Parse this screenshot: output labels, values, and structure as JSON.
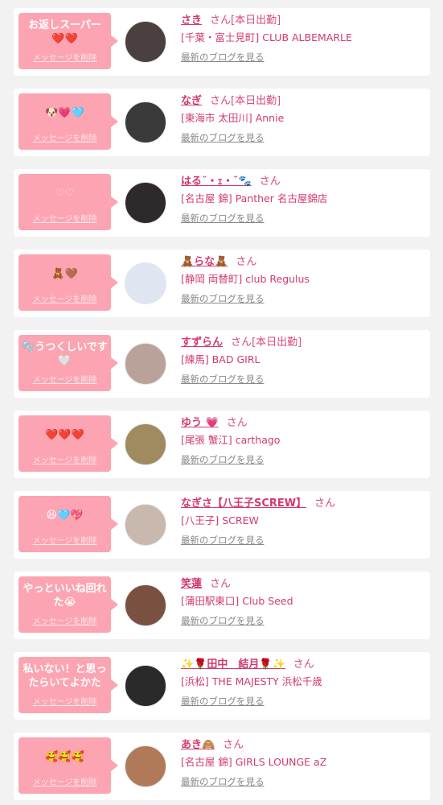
{
  "ui": {
    "delete_label": "メッセージを削除",
    "blog_label": "最新のブログを見る",
    "honorific": "さん"
  },
  "colors": {
    "bubble_pink": "#fca4b2",
    "name_pink": "#d23a6b",
    "link_gray": "#888888",
    "card_bg": "#ffffff",
    "page_bg": "#f2f2f2"
  },
  "entries": [
    {
      "message": "お返しスーパー❤️❤️",
      "faint": false,
      "name": "さき",
      "tag": "[本日出勤]",
      "shop": "[千葉・富士見町] CLUB ALBEMARLE",
      "avatar_bg": "#4a4040"
    },
    {
      "message": "🐶💗🩵",
      "faint": false,
      "name": "なぎ",
      "tag": "[本日出勤]",
      "shop": "[東海市 太田川] Annie",
      "avatar_bg": "#3a3a3a"
    },
    {
      "message": "♡♡",
      "faint": true,
      "name": "はる˘・ｪ・˘🐾",
      "tag": "",
      "shop": "[名古屋 錦] Panther 名古屋錦店",
      "avatar_bg": "#2e2a2c"
    },
    {
      "message": "🧸🤎",
      "faint": false,
      "name": "🧸らな🧸",
      "tag": "",
      "shop": "[静岡 両替町] club Regulus",
      "avatar_bg": "#dfe6f1"
    },
    {
      "message": "🫧うつくしいです🤍",
      "faint": false,
      "name": "すずらん",
      "tag": "[本日出勤]",
      "shop": "[練馬] BAD GIRL",
      "avatar_bg": "#b8a29a"
    },
    {
      "message": "❤️❤️❤️",
      "faint": false,
      "name": "ゆう 💗",
      "tag": "",
      "shop": "[尾張 蟹江] carthago",
      "avatar_bg": "#a08a60"
    },
    {
      "message": "😆🩵💖",
      "faint": false,
      "name": "なぎさ【八王子SCREW】",
      "tag": "",
      "shop": "[八王子] SCREW",
      "avatar_bg": "#c8b8ae"
    },
    {
      "message": "やっといいね回れた😭",
      "faint": false,
      "name": "笑蓮",
      "tag": "",
      "shop": "[蒲田駅東口] Club Seed",
      "avatar_bg": "#7a5040"
    },
    {
      "message": "私いない！と思ったらいてよかた",
      "faint": false,
      "name": "✨🌹田中　結月🌹✨",
      "tag": "",
      "shop": "[浜松] THE MAJESTY 浜松千歳",
      "avatar_bg": "#2a2a2a"
    },
    {
      "message": "🥰🥰🥰",
      "faint": false,
      "name": "あき🙈",
      "tag": "",
      "shop": "[名古屋 錦] GIRLS LOUNGE aZ",
      "avatar_bg": "#b07a58"
    }
  ]
}
